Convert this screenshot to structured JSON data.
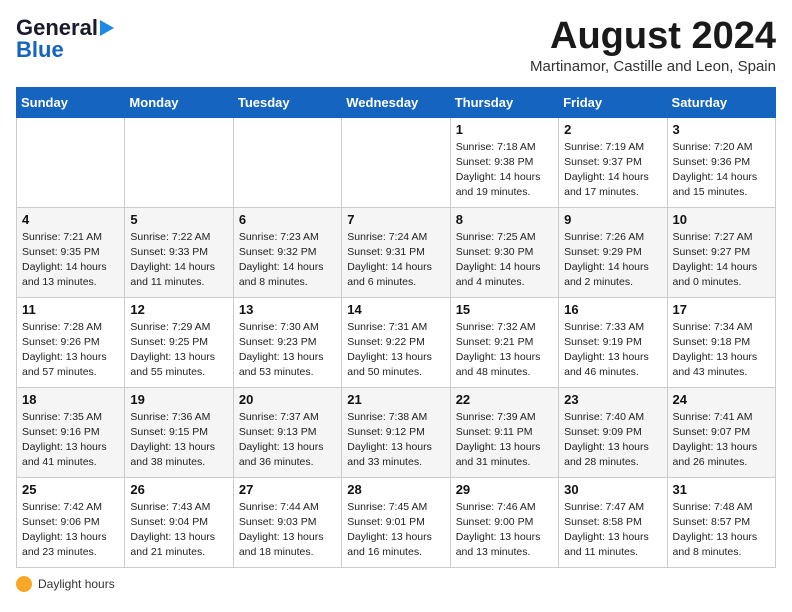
{
  "header": {
    "logo_line1": "General",
    "logo_line2": "Blue",
    "month": "August 2024",
    "location": "Martinamor, Castille and Leon, Spain"
  },
  "days_of_week": [
    "Sunday",
    "Monday",
    "Tuesday",
    "Wednesday",
    "Thursday",
    "Friday",
    "Saturday"
  ],
  "weeks": [
    [
      {
        "day": "",
        "info": ""
      },
      {
        "day": "",
        "info": ""
      },
      {
        "day": "",
        "info": ""
      },
      {
        "day": "",
        "info": ""
      },
      {
        "day": "1",
        "info": "Sunrise: 7:18 AM\nSunset: 9:38 PM\nDaylight: 14 hours\nand 19 minutes."
      },
      {
        "day": "2",
        "info": "Sunrise: 7:19 AM\nSunset: 9:37 PM\nDaylight: 14 hours\nand 17 minutes."
      },
      {
        "day": "3",
        "info": "Sunrise: 7:20 AM\nSunset: 9:36 PM\nDaylight: 14 hours\nand 15 minutes."
      }
    ],
    [
      {
        "day": "4",
        "info": "Sunrise: 7:21 AM\nSunset: 9:35 PM\nDaylight: 14 hours\nand 13 minutes."
      },
      {
        "day": "5",
        "info": "Sunrise: 7:22 AM\nSunset: 9:33 PM\nDaylight: 14 hours\nand 11 minutes."
      },
      {
        "day": "6",
        "info": "Sunrise: 7:23 AM\nSunset: 9:32 PM\nDaylight: 14 hours\nand 8 minutes."
      },
      {
        "day": "7",
        "info": "Sunrise: 7:24 AM\nSunset: 9:31 PM\nDaylight: 14 hours\nand 6 minutes."
      },
      {
        "day": "8",
        "info": "Sunrise: 7:25 AM\nSunset: 9:30 PM\nDaylight: 14 hours\nand 4 minutes."
      },
      {
        "day": "9",
        "info": "Sunrise: 7:26 AM\nSunset: 9:29 PM\nDaylight: 14 hours\nand 2 minutes."
      },
      {
        "day": "10",
        "info": "Sunrise: 7:27 AM\nSunset: 9:27 PM\nDaylight: 14 hours\nand 0 minutes."
      }
    ],
    [
      {
        "day": "11",
        "info": "Sunrise: 7:28 AM\nSunset: 9:26 PM\nDaylight: 13 hours\nand 57 minutes."
      },
      {
        "day": "12",
        "info": "Sunrise: 7:29 AM\nSunset: 9:25 PM\nDaylight: 13 hours\nand 55 minutes."
      },
      {
        "day": "13",
        "info": "Sunrise: 7:30 AM\nSunset: 9:23 PM\nDaylight: 13 hours\nand 53 minutes."
      },
      {
        "day": "14",
        "info": "Sunrise: 7:31 AM\nSunset: 9:22 PM\nDaylight: 13 hours\nand 50 minutes."
      },
      {
        "day": "15",
        "info": "Sunrise: 7:32 AM\nSunset: 9:21 PM\nDaylight: 13 hours\nand 48 minutes."
      },
      {
        "day": "16",
        "info": "Sunrise: 7:33 AM\nSunset: 9:19 PM\nDaylight: 13 hours\nand 46 minutes."
      },
      {
        "day": "17",
        "info": "Sunrise: 7:34 AM\nSunset: 9:18 PM\nDaylight: 13 hours\nand 43 minutes."
      }
    ],
    [
      {
        "day": "18",
        "info": "Sunrise: 7:35 AM\nSunset: 9:16 PM\nDaylight: 13 hours\nand 41 minutes."
      },
      {
        "day": "19",
        "info": "Sunrise: 7:36 AM\nSunset: 9:15 PM\nDaylight: 13 hours\nand 38 minutes."
      },
      {
        "day": "20",
        "info": "Sunrise: 7:37 AM\nSunset: 9:13 PM\nDaylight: 13 hours\nand 36 minutes."
      },
      {
        "day": "21",
        "info": "Sunrise: 7:38 AM\nSunset: 9:12 PM\nDaylight: 13 hours\nand 33 minutes."
      },
      {
        "day": "22",
        "info": "Sunrise: 7:39 AM\nSunset: 9:11 PM\nDaylight: 13 hours\nand 31 minutes."
      },
      {
        "day": "23",
        "info": "Sunrise: 7:40 AM\nSunset: 9:09 PM\nDaylight: 13 hours\nand 28 minutes."
      },
      {
        "day": "24",
        "info": "Sunrise: 7:41 AM\nSunset: 9:07 PM\nDaylight: 13 hours\nand 26 minutes."
      }
    ],
    [
      {
        "day": "25",
        "info": "Sunrise: 7:42 AM\nSunset: 9:06 PM\nDaylight: 13 hours\nand 23 minutes."
      },
      {
        "day": "26",
        "info": "Sunrise: 7:43 AM\nSunset: 9:04 PM\nDaylight: 13 hours\nand 21 minutes."
      },
      {
        "day": "27",
        "info": "Sunrise: 7:44 AM\nSunset: 9:03 PM\nDaylight: 13 hours\nand 18 minutes."
      },
      {
        "day": "28",
        "info": "Sunrise: 7:45 AM\nSunset: 9:01 PM\nDaylight: 13 hours\nand 16 minutes."
      },
      {
        "day": "29",
        "info": "Sunrise: 7:46 AM\nSunset: 9:00 PM\nDaylight: 13 hours\nand 13 minutes."
      },
      {
        "day": "30",
        "info": "Sunrise: 7:47 AM\nSunset: 8:58 PM\nDaylight: 13 hours\nand 11 minutes."
      },
      {
        "day": "31",
        "info": "Sunrise: 7:48 AM\nSunset: 8:57 PM\nDaylight: 13 hours\nand 8 minutes."
      }
    ]
  ],
  "footer": {
    "label": "Daylight hours"
  }
}
